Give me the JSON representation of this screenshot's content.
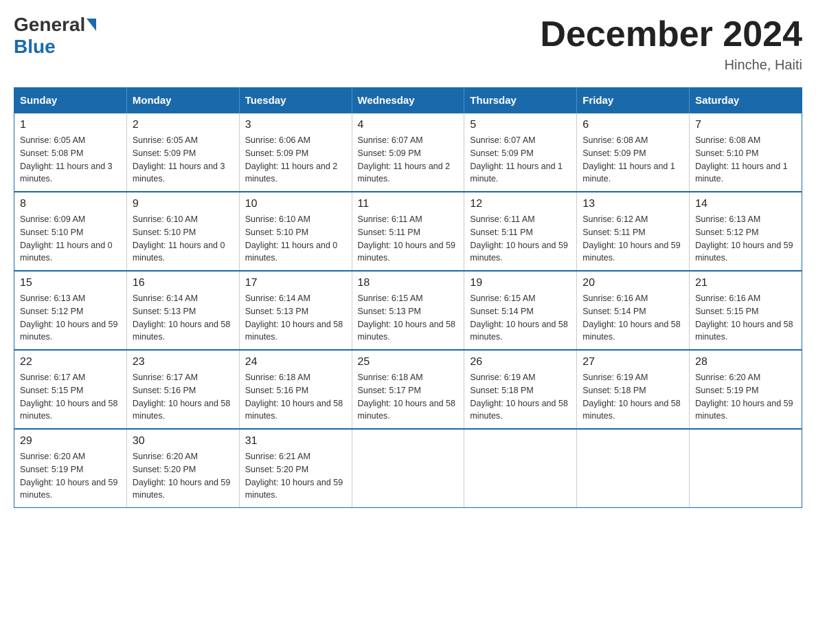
{
  "header": {
    "logo_general": "General",
    "logo_blue": "Blue",
    "title": "December 2024",
    "subtitle": "Hinche, Haiti"
  },
  "days_of_week": [
    "Sunday",
    "Monday",
    "Tuesday",
    "Wednesday",
    "Thursday",
    "Friday",
    "Saturday"
  ],
  "weeks": [
    [
      {
        "day": "1",
        "sunrise": "6:05 AM",
        "sunset": "5:08 PM",
        "daylight": "11 hours and 3 minutes."
      },
      {
        "day": "2",
        "sunrise": "6:05 AM",
        "sunset": "5:09 PM",
        "daylight": "11 hours and 3 minutes."
      },
      {
        "day": "3",
        "sunrise": "6:06 AM",
        "sunset": "5:09 PM",
        "daylight": "11 hours and 2 minutes."
      },
      {
        "day": "4",
        "sunrise": "6:07 AM",
        "sunset": "5:09 PM",
        "daylight": "11 hours and 2 minutes."
      },
      {
        "day": "5",
        "sunrise": "6:07 AM",
        "sunset": "5:09 PM",
        "daylight": "11 hours and 1 minute."
      },
      {
        "day": "6",
        "sunrise": "6:08 AM",
        "sunset": "5:09 PM",
        "daylight": "11 hours and 1 minute."
      },
      {
        "day": "7",
        "sunrise": "6:08 AM",
        "sunset": "5:10 PM",
        "daylight": "11 hours and 1 minute."
      }
    ],
    [
      {
        "day": "8",
        "sunrise": "6:09 AM",
        "sunset": "5:10 PM",
        "daylight": "11 hours and 0 minutes."
      },
      {
        "day": "9",
        "sunrise": "6:10 AM",
        "sunset": "5:10 PM",
        "daylight": "11 hours and 0 minutes."
      },
      {
        "day": "10",
        "sunrise": "6:10 AM",
        "sunset": "5:10 PM",
        "daylight": "11 hours and 0 minutes."
      },
      {
        "day": "11",
        "sunrise": "6:11 AM",
        "sunset": "5:11 PM",
        "daylight": "10 hours and 59 minutes."
      },
      {
        "day": "12",
        "sunrise": "6:11 AM",
        "sunset": "5:11 PM",
        "daylight": "10 hours and 59 minutes."
      },
      {
        "day": "13",
        "sunrise": "6:12 AM",
        "sunset": "5:11 PM",
        "daylight": "10 hours and 59 minutes."
      },
      {
        "day": "14",
        "sunrise": "6:13 AM",
        "sunset": "5:12 PM",
        "daylight": "10 hours and 59 minutes."
      }
    ],
    [
      {
        "day": "15",
        "sunrise": "6:13 AM",
        "sunset": "5:12 PM",
        "daylight": "10 hours and 59 minutes."
      },
      {
        "day": "16",
        "sunrise": "6:14 AM",
        "sunset": "5:13 PM",
        "daylight": "10 hours and 58 minutes."
      },
      {
        "day": "17",
        "sunrise": "6:14 AM",
        "sunset": "5:13 PM",
        "daylight": "10 hours and 58 minutes."
      },
      {
        "day": "18",
        "sunrise": "6:15 AM",
        "sunset": "5:13 PM",
        "daylight": "10 hours and 58 minutes."
      },
      {
        "day": "19",
        "sunrise": "6:15 AM",
        "sunset": "5:14 PM",
        "daylight": "10 hours and 58 minutes."
      },
      {
        "day": "20",
        "sunrise": "6:16 AM",
        "sunset": "5:14 PM",
        "daylight": "10 hours and 58 minutes."
      },
      {
        "day": "21",
        "sunrise": "6:16 AM",
        "sunset": "5:15 PM",
        "daylight": "10 hours and 58 minutes."
      }
    ],
    [
      {
        "day": "22",
        "sunrise": "6:17 AM",
        "sunset": "5:15 PM",
        "daylight": "10 hours and 58 minutes."
      },
      {
        "day": "23",
        "sunrise": "6:17 AM",
        "sunset": "5:16 PM",
        "daylight": "10 hours and 58 minutes."
      },
      {
        "day": "24",
        "sunrise": "6:18 AM",
        "sunset": "5:16 PM",
        "daylight": "10 hours and 58 minutes."
      },
      {
        "day": "25",
        "sunrise": "6:18 AM",
        "sunset": "5:17 PM",
        "daylight": "10 hours and 58 minutes."
      },
      {
        "day": "26",
        "sunrise": "6:19 AM",
        "sunset": "5:18 PM",
        "daylight": "10 hours and 58 minutes."
      },
      {
        "day": "27",
        "sunrise": "6:19 AM",
        "sunset": "5:18 PM",
        "daylight": "10 hours and 58 minutes."
      },
      {
        "day": "28",
        "sunrise": "6:20 AM",
        "sunset": "5:19 PM",
        "daylight": "10 hours and 59 minutes."
      }
    ],
    [
      {
        "day": "29",
        "sunrise": "6:20 AM",
        "sunset": "5:19 PM",
        "daylight": "10 hours and 59 minutes."
      },
      {
        "day": "30",
        "sunrise": "6:20 AM",
        "sunset": "5:20 PM",
        "daylight": "10 hours and 59 minutes."
      },
      {
        "day": "31",
        "sunrise": "6:21 AM",
        "sunset": "5:20 PM",
        "daylight": "10 hours and 59 minutes."
      },
      null,
      null,
      null,
      null
    ]
  ]
}
